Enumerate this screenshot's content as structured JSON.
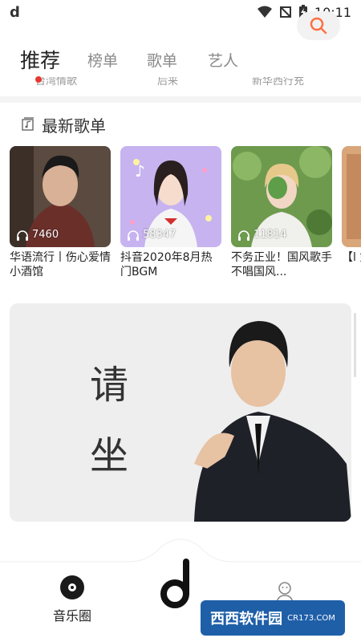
{
  "status_bar": {
    "app_glyph": "d",
    "time": "10:11"
  },
  "tabs": [
    {
      "label": "推荐",
      "active": true
    },
    {
      "label": "榜单",
      "active": false
    },
    {
      "label": "歌单",
      "active": false
    },
    {
      "label": "艺人",
      "active": false
    }
  ],
  "ghost_row": [
    "台湾情歌",
    "后来",
    "新华西行充"
  ],
  "latest_playlists": {
    "title": "最新歌单",
    "items": [
      {
        "count": "7460",
        "title": "华语流行丨伤心爱情小酒馆"
      },
      {
        "count": "58347",
        "title": "抖音2020年8月热门BGM"
      },
      {
        "count": "11814",
        "title": "不务正业！国风歌手不唱国风..."
      },
      {
        "count": "",
        "title": "【l 如旧"
      }
    ]
  },
  "banner": {
    "line1": "请",
    "line2": "坐"
  },
  "bottom_nav": {
    "left_label": "音乐圈",
    "center_glyph": "d"
  },
  "watermark": {
    "text": "西西软件园",
    "sub": "CR173.COM"
  },
  "colors": {
    "accent": "#e53935",
    "search_icon": "#ff7043",
    "tab_inactive": "#8a8a8a"
  }
}
